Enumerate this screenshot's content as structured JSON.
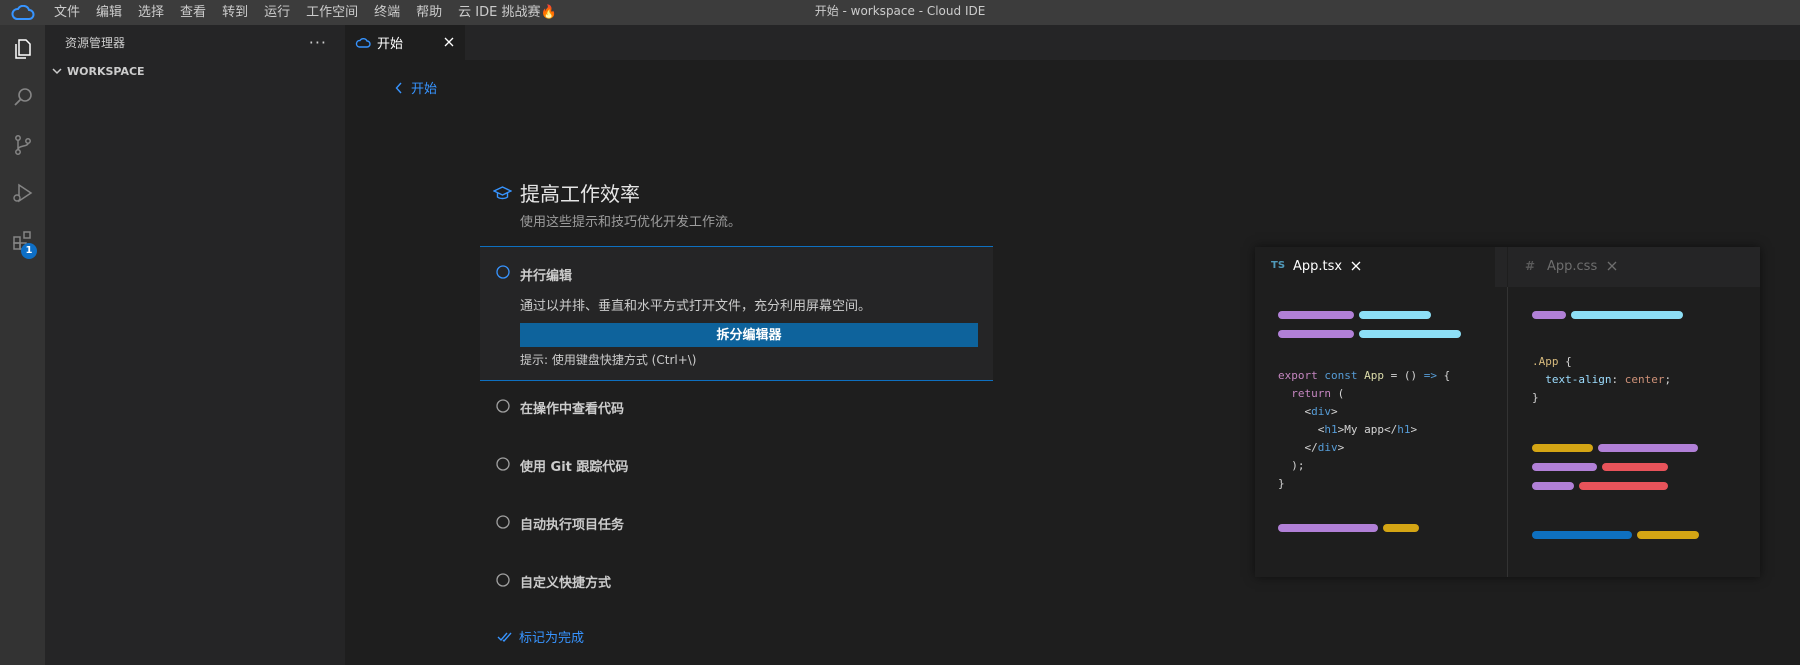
{
  "window": {
    "title": "开始 - workspace - Cloud IDE"
  },
  "menu": [
    "文件",
    "编辑",
    "选择",
    "查看",
    "转到",
    "运行",
    "工作空间",
    "终端",
    "帮助",
    "云 IDE 挑战赛🔥"
  ],
  "activity_bar": {
    "extensions_badge": "1"
  },
  "sidebar": {
    "title": "资源管理器",
    "more": "···",
    "section": "WORKSPACE"
  },
  "tab": {
    "label": "开始"
  },
  "walkthrough": {
    "back_label": "开始",
    "title": "提高工作效率",
    "subtitle": "使用这些提示和技巧优化开发工作流。",
    "active_step": {
      "title": "并行编辑",
      "description": "通过以并排、垂直和水平方式打开文件，充分利用屏幕空间。",
      "button": "拆分编辑器",
      "hint": "提示: 使用键盘快捷方式 (Ctrl+\\)"
    },
    "steps": [
      "在操作中查看代码",
      "使用 Git 跟踪代码",
      "自动执行项目任务",
      "自定义快捷方式"
    ],
    "mark_done": "标记为完成"
  },
  "preview": {
    "tab1": {
      "badge": "TS",
      "name": "App.tsx"
    },
    "tab2": {
      "badge": "#",
      "name": "App.css"
    },
    "colors": {
      "purple": "#b180d7",
      "cyan": "#8ddff6",
      "yellow": "#d4a514",
      "red": "#e8535a",
      "blue": "#0e70c0"
    }
  }
}
